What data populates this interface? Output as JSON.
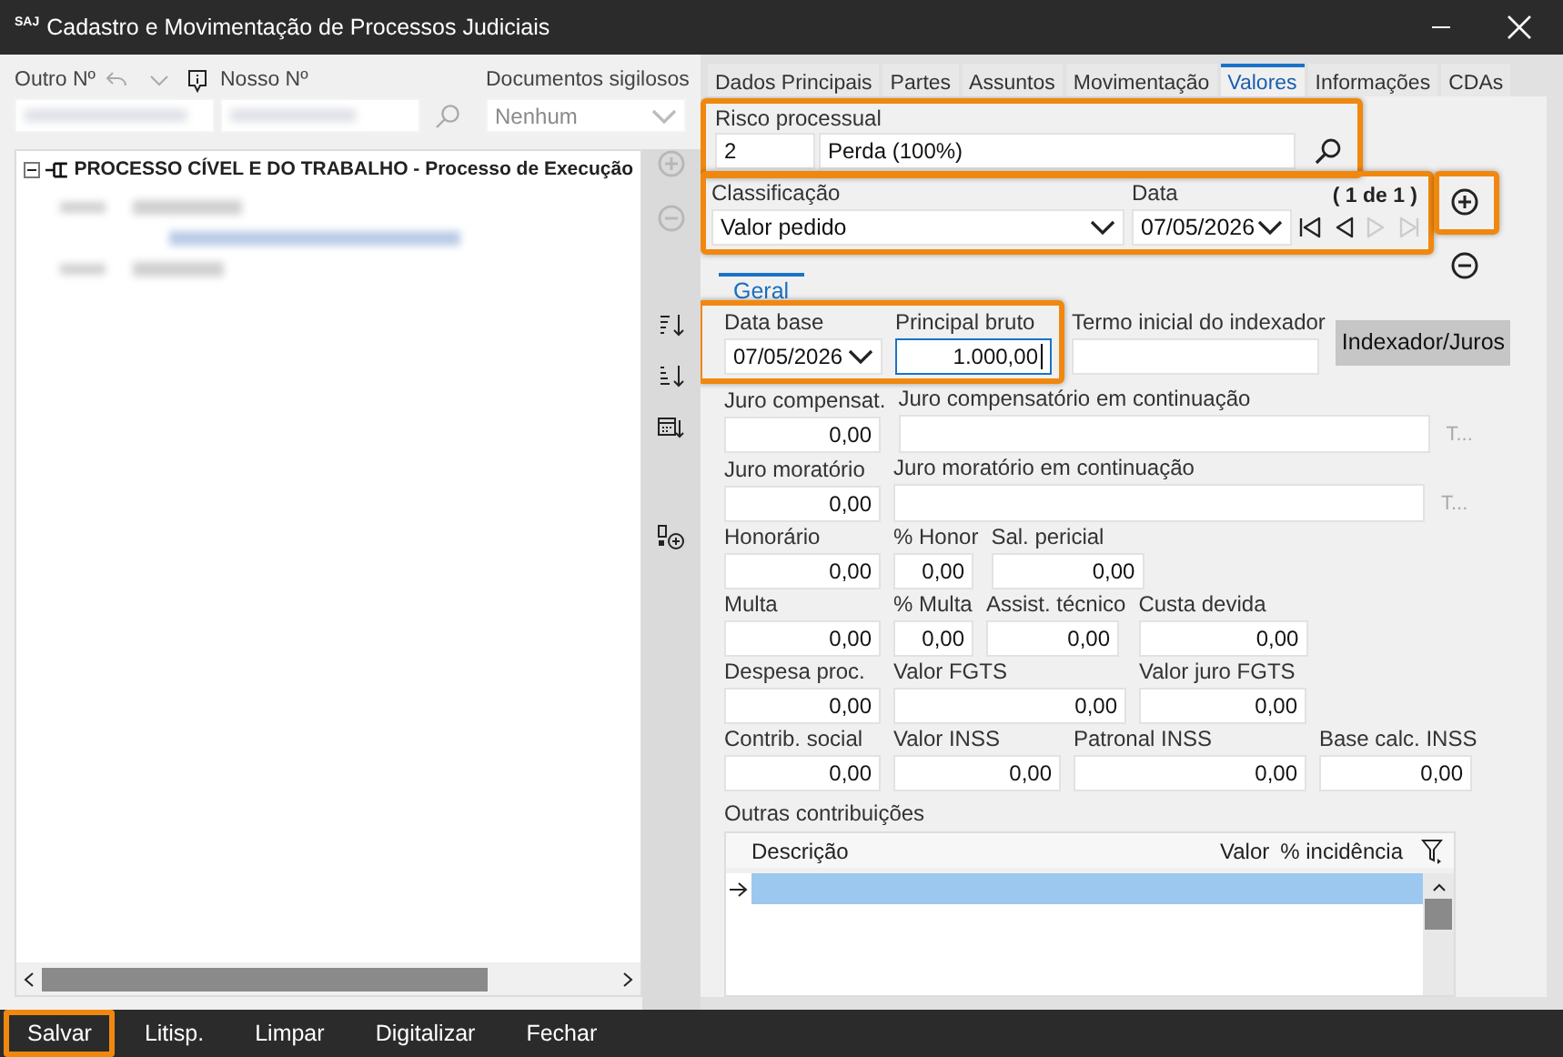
{
  "window": {
    "logo": "SAJ",
    "title": "Cadastro e Movimentação de Processos Judiciais"
  },
  "lookup": {
    "other_number": {
      "label": "Outro Nº"
    },
    "our_number": {
      "label": "Nosso Nº"
    },
    "confidential": {
      "label": "Documentos sigilosos",
      "value": "Nenhum",
      "disabled": true
    }
  },
  "tree": {
    "items": [
      {
        "label": "PROCESSO CÍVEL E DO TRABALHO - Processo de Execução",
        "expanded": true
      }
    ]
  },
  "tree_actions": [
    {
      "kind": "add",
      "disabled": true
    },
    {
      "kind": "remove",
      "disabled": true
    }
  ],
  "sort_tools": [
    {
      "kind": "sort-az"
    },
    {
      "kind": "sort-za"
    },
    {
      "kind": "sort-date"
    },
    {
      "kind": "add-field"
    }
  ],
  "tabs": [
    {
      "label": "Dados Principais",
      "selected": false
    },
    {
      "label": "Partes",
      "selected": false
    },
    {
      "label": "Assuntos",
      "selected": false
    },
    {
      "label": "Movimentação",
      "selected": false
    },
    {
      "label": "Valores",
      "selected": true
    },
    {
      "label": "Informações",
      "selected": false
    },
    {
      "label": "CDAs",
      "selected": false
    }
  ],
  "risk": {
    "label": "Risco processual",
    "code": "2",
    "description": "Perda  (100%)",
    "highlighted": true
  },
  "classification": {
    "label": "Classificação",
    "value": "Valor pedido",
    "date_label": "Data",
    "date": "07/05/2026",
    "record_count": "( 1 de 1 )",
    "highlighted": true
  },
  "navigation": [
    {
      "kind": "first",
      "disabled": false
    },
    {
      "kind": "previous",
      "disabled": false
    },
    {
      "kind": "next",
      "disabled": true
    },
    {
      "kind": "last",
      "disabled": true
    }
  ],
  "value_actions": [
    {
      "kind": "add",
      "disabled": false,
      "highlighted": true
    },
    {
      "kind": "remove",
      "disabled": false,
      "highlighted": false
    }
  ],
  "subtabs": [
    {
      "label": "Geral",
      "selected": true
    }
  ],
  "highlighted_fields": {
    "highlighted": true,
    "fields": [
      {
        "kind": "date",
        "label": "Data base",
        "value": "07/05/2026"
      },
      {
        "kind": "number",
        "label": "Principal bruto",
        "value": "1.000,00",
        "focused": true
      }
    ]
  },
  "rows": [
    [
      {
        "kind": "text",
        "label": "Termo inicial do indexador"
      },
      {
        "kind": "button",
        "text": "Indexador/Juros"
      }
    ],
    [
      {
        "kind": "number",
        "label": "Juro compensat.",
        "value": "0,00"
      },
      {
        "kind": "text",
        "label": "Juro compensatório em continuação"
      },
      {
        "kind": "link",
        "text": "T...",
        "disabled": true
      }
    ],
    [
      {
        "kind": "number",
        "label": "Juro moratório",
        "value": "0,00"
      },
      {
        "kind": "text",
        "label": "Juro moratório em continuação"
      },
      {
        "kind": "link",
        "text": "T...",
        "disabled": true
      }
    ],
    [
      {
        "kind": "number",
        "label": "Honorário",
        "value": "0,00"
      },
      {
        "kind": "number",
        "label": "% Honor",
        "value": "0,00"
      },
      {
        "kind": "number",
        "label": "Sal. pericial",
        "value": "0,00"
      }
    ],
    [
      {
        "kind": "number",
        "label": "Multa",
        "value": "0,00"
      },
      {
        "kind": "number",
        "label": "% Multa",
        "value": "0,00"
      },
      {
        "kind": "number",
        "label": "Assist. técnico",
        "value": "0,00"
      },
      {
        "kind": "number",
        "label": "Custa devida",
        "value": "0,00"
      }
    ],
    [
      {
        "kind": "number",
        "label": "Despesa proc.",
        "value": "0,00"
      },
      {
        "kind": "number",
        "label": "Valor FGTS",
        "value": "0,00"
      },
      {
        "kind": "number",
        "label": "Valor juro FGTS",
        "value": "0,00"
      }
    ],
    [
      {
        "kind": "number",
        "label": "Contrib. social",
        "value": "0,00"
      },
      {
        "kind": "number",
        "label": "Valor INSS",
        "value": "0,00"
      },
      {
        "kind": "number",
        "label": "Patronal INSS",
        "value": "0,00"
      },
      {
        "kind": "number",
        "label": "Base calc. INSS",
        "value": "0,00"
      }
    ]
  ],
  "other_contributions": {
    "label": "Outras contribuições",
    "columns": [
      "Descrição",
      "Valor",
      "% incidência"
    ],
    "rows": [
      {
        "selected": true
      }
    ]
  },
  "footer_buttons": [
    {
      "label": "Salvar",
      "highlighted": true
    },
    {
      "label": "Litisp.",
      "highlighted": false
    },
    {
      "label": "Limpar",
      "highlighted": false
    },
    {
      "label": "Digitalizar",
      "highlighted": false
    },
    {
      "label": "Fechar",
      "highlighted": false
    }
  ]
}
